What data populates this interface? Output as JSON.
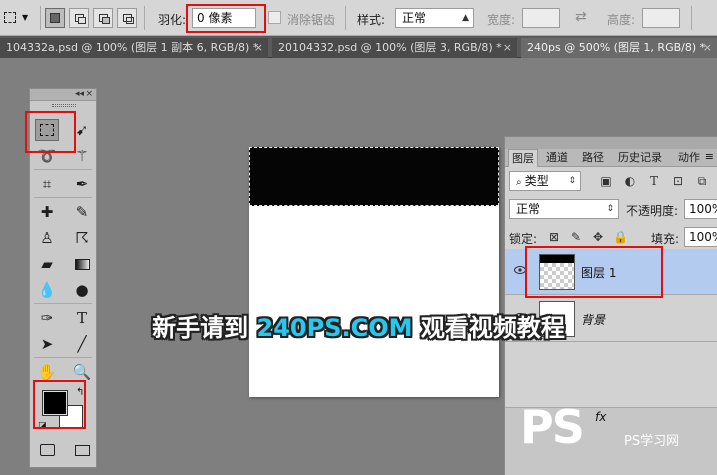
{
  "options_bar": {
    "feather_label": "羽化:",
    "feather_value": "0 像素",
    "anti_alias_label": "消除锯齿",
    "style_label": "样式:",
    "style_value": "正常",
    "width_label": "宽度:",
    "height_label": "高度:"
  },
  "doc_tabs": [
    {
      "title": "104332a.psd @ 100% (图层 1 副本 6, RGB/8) *"
    },
    {
      "title": "20104332.psd @ 100% (图层 3, RGB/8) *"
    },
    {
      "title": "240ps @ 500% (图层 1, RGB/8) *"
    }
  ],
  "toolbox": {
    "collapse": "◂◂",
    "close": "×"
  },
  "layers_panel": {
    "tabs": [
      "图层",
      "通道",
      "路径",
      "历史记录",
      "动作"
    ],
    "filter_label": "类型",
    "blend_mode": "正常",
    "opacity_label": "不透明度:",
    "opacity_value": "100%",
    "lock_label": "锁定:",
    "fill_label": "填充:",
    "fill_value": "100%",
    "layers": [
      {
        "name": "图层 1",
        "selected": true
      },
      {
        "name": "背景",
        "selected": false
      }
    ]
  },
  "overlay_text": {
    "prefix": "新手请到 ",
    "highlight": "240PS.COM",
    "suffix": " 观看视频教程"
  },
  "watermark": {
    "big": "PS",
    "small": "PS学习网"
  },
  "colors": {
    "foreground": "#000000",
    "background": "#ffffff",
    "highlight_box": "#e01010",
    "selected_layer": "#b4cbf0"
  }
}
